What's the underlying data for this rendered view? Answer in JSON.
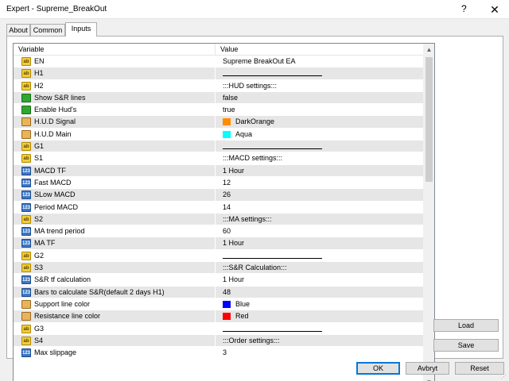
{
  "window": {
    "title": "Expert - Supreme_BreakOut",
    "help_label": "?",
    "close_label": "✕"
  },
  "tabs": [
    {
      "label": "About"
    },
    {
      "label": "Common"
    },
    {
      "label": "Inputs",
      "active": true
    }
  ],
  "grid": {
    "col_variable": "Variable",
    "col_value": "Value",
    "rows": [
      {
        "type": "ab",
        "name": "EN",
        "value": "Supreme BreakOut EA"
      },
      {
        "type": "ab",
        "name": "H1",
        "value": "",
        "line": true
      },
      {
        "type": "ab",
        "name": "H2",
        "value": ":::HUD settings:::"
      },
      {
        "type": "bool",
        "name": "Show S&R lines",
        "value": "false"
      },
      {
        "type": "bool",
        "name": "Enable Hud's",
        "value": "true"
      },
      {
        "type": "color",
        "name": "H.U.D Signal",
        "value": "DarkOrange",
        "swatch": "#ff8c00"
      },
      {
        "type": "color",
        "name": "H.U.D Main",
        "value": "Aqua",
        "swatch": "#00ffff"
      },
      {
        "type": "ab",
        "name": "G1",
        "value": "",
        "line": true
      },
      {
        "type": "ab",
        "name": "S1",
        "value": ":::MACD settings:::"
      },
      {
        "type": "num",
        "name": "MACD TF",
        "value": "1 Hour"
      },
      {
        "type": "num",
        "name": "Fast MACD",
        "value": "12"
      },
      {
        "type": "num",
        "name": "SLow MACD",
        "value": "26"
      },
      {
        "type": "num",
        "name": "Period MACD",
        "value": "14"
      },
      {
        "type": "ab",
        "name": "S2",
        "value": ":::MA settings:::"
      },
      {
        "type": "num",
        "name": "MA trend period",
        "value": "60"
      },
      {
        "type": "num",
        "name": "MA TF",
        "value": "1 Hour"
      },
      {
        "type": "ab",
        "name": "G2",
        "value": "",
        "line": true
      },
      {
        "type": "ab",
        "name": "S3",
        "value": ":::S&R Calculation:::"
      },
      {
        "type": "num",
        "name": "S&R tf calculation",
        "value": "1 Hour"
      },
      {
        "type": "num",
        "name": "Bars to calculate S&R(default 2 days H1)",
        "value": "48"
      },
      {
        "type": "color",
        "name": "Support line color",
        "value": "Blue",
        "swatch": "#0000ff"
      },
      {
        "type": "color",
        "name": "Resistance line color",
        "value": "Red",
        "swatch": "#ff0000"
      },
      {
        "type": "ab",
        "name": "G3",
        "value": "",
        "line": true
      },
      {
        "type": "ab",
        "name": "S4",
        "value": ":::Order settings:::"
      },
      {
        "type": "num",
        "name": "Max slippage",
        "value": "3"
      }
    ]
  },
  "side_buttons": {
    "load": "Load",
    "save": "Save"
  },
  "footer_buttons": {
    "ok": "OK",
    "cancel": "Avbryt",
    "reset": "Reset"
  },
  "icon_glyphs": {
    "ab": "ab",
    "bool": "",
    "color": "",
    "num": "123"
  }
}
